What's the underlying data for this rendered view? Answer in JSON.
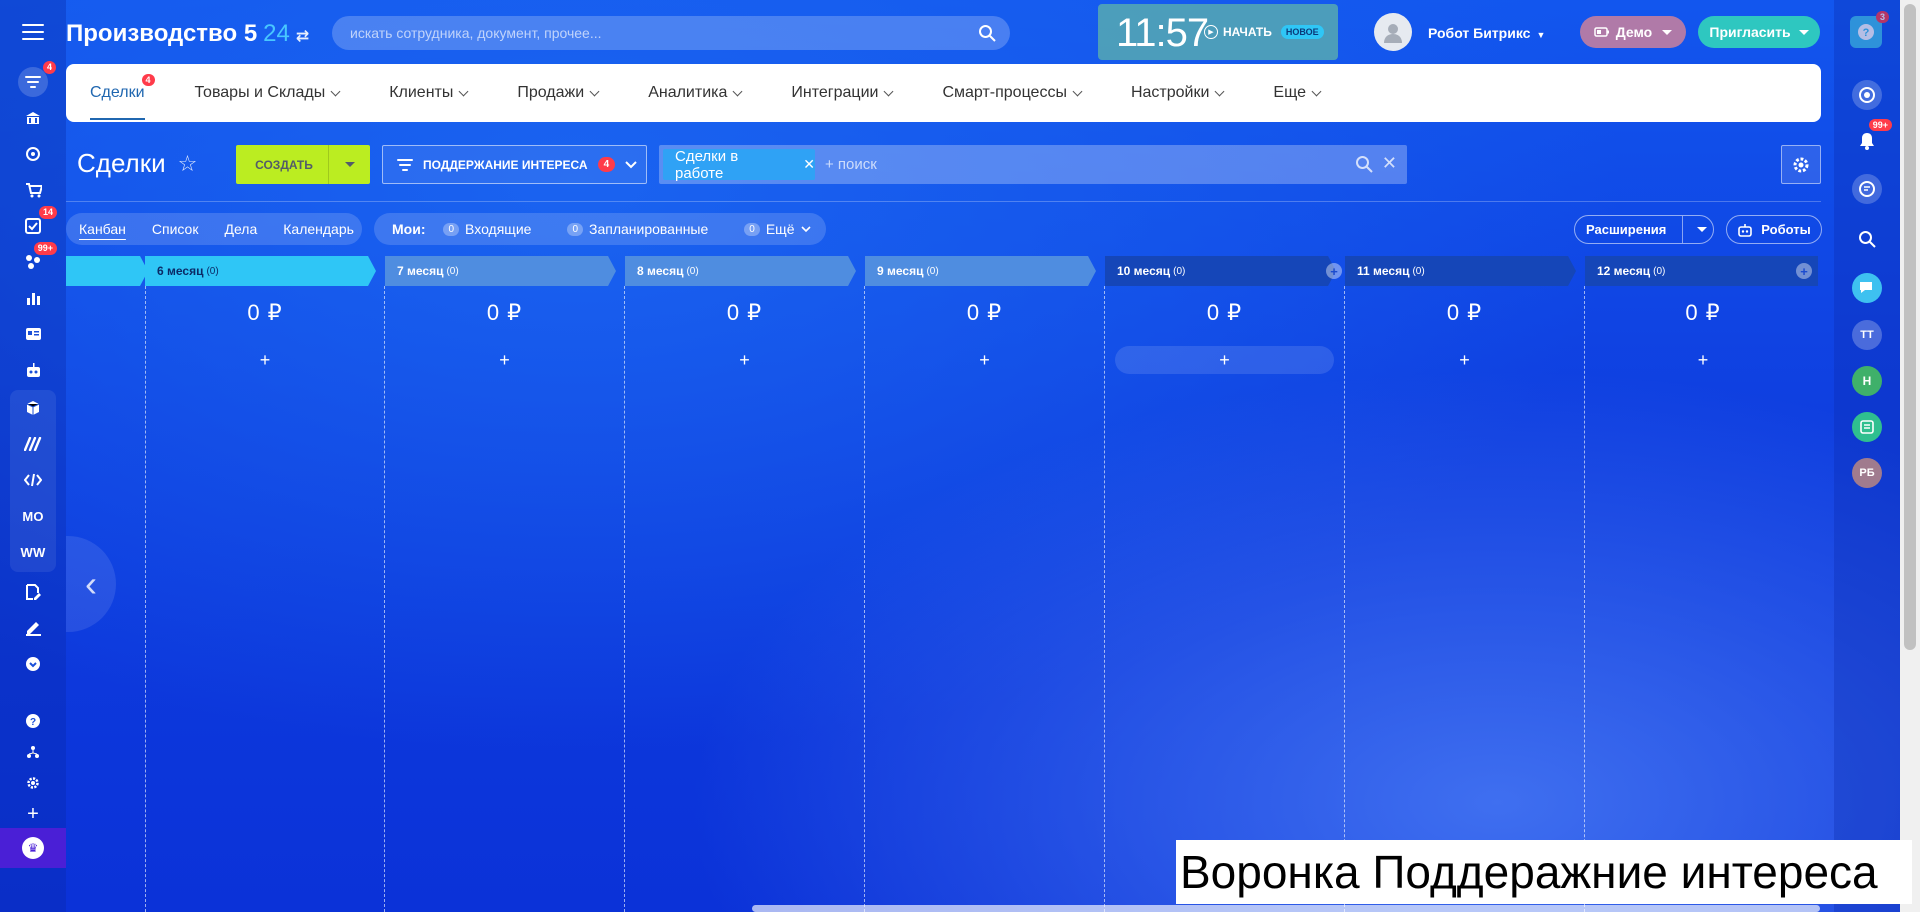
{
  "left_sidebar": {
    "items": [
      {
        "icon": "filter-icon",
        "badge": "4"
      },
      {
        "icon": "bank-icon",
        "badge": ""
      },
      {
        "icon": "target-icon",
        "badge": ""
      },
      {
        "icon": "cart-icon",
        "badge": ""
      },
      {
        "icon": "tasks-check-icon",
        "badge": "14"
      },
      {
        "icon": "scheme-icon",
        "badge": "99+"
      },
      {
        "icon": "chart-bars-icon",
        "badge": ""
      },
      {
        "icon": "contact-card-icon",
        "badge": ""
      },
      {
        "icon": "robot-icon",
        "badge": ""
      },
      {
        "icon": "cube-icon",
        "badge": ""
      },
      {
        "icon": "sites-icon",
        "badge": ""
      },
      {
        "icon": "code-icon",
        "badge": ""
      },
      {
        "icon": "mo-text-icon",
        "badge": "",
        "text": "MO"
      },
      {
        "icon": "ww-text-icon",
        "badge": "",
        "text": "WW"
      },
      {
        "icon": "document-edit-icon",
        "badge": ""
      },
      {
        "icon": "sign-icon",
        "badge": ""
      },
      {
        "icon": "chevron-circle-icon",
        "badge": ""
      },
      {
        "icon": "help-circle-icon",
        "badge": ""
      },
      {
        "icon": "structure-icon",
        "badge": ""
      },
      {
        "icon": "gear-icon",
        "badge": ""
      },
      {
        "icon": "plus-icon",
        "badge": ""
      },
      {
        "icon": "crown-icon",
        "badge": ""
      }
    ]
  },
  "header": {
    "portal_name": "Производство 5",
    "portal_suffix": "24",
    "search_placeholder": "искать сотрудника, документ, прочее...",
    "clock": "11:57",
    "start_label": "НАЧАТЬ",
    "new_badge": "НОВОЕ",
    "user_name": "Робот Битрикс",
    "demo_label": "Демо",
    "invite_label": "Пригласить",
    "help_badge": "3"
  },
  "topnav": {
    "items": [
      {
        "label": "Сделки",
        "badge": "4",
        "active": true
      },
      {
        "label": "Товары и Склады"
      },
      {
        "label": "Клиенты"
      },
      {
        "label": "Продажи"
      },
      {
        "label": "Аналитика"
      },
      {
        "label": "Интеграции"
      },
      {
        "label": "Смарт-процессы"
      },
      {
        "label": "Настройки"
      },
      {
        "label": "Еще"
      }
    ]
  },
  "toolbar": {
    "page_title": "Сделки",
    "create_label": "СОЗДАТЬ",
    "funnel_label": "ПОДДЕРЖАНИЕ ИНТЕРЕСА",
    "funnel_badge": "4",
    "filter_chip": "Сделки в работе",
    "filter_placeholder": "+ поиск"
  },
  "views": {
    "tabs": [
      "Канбан",
      "Список",
      "Дела",
      "Календарь"
    ],
    "my_label": "Мои:",
    "counters": [
      {
        "count": "0",
        "label": "Входящие"
      },
      {
        "count": "0",
        "label": "Запланированные"
      },
      {
        "count": "0",
        "label": "Ещё"
      }
    ],
    "extensions_label": "Расширения",
    "robots_label": "Роботы"
  },
  "kanban": {
    "stages": [
      {
        "name": "6 месяц",
        "count": "(0)",
        "sum": "0 ₽",
        "color": "#2fc6f6"
      },
      {
        "name": "7 месяц",
        "count": "(0)",
        "sum": "0 ₽",
        "color": "#4f8de0"
      },
      {
        "name": "8 месяц",
        "count": "(0)",
        "sum": "0 ₽",
        "color": "#4f8de0"
      },
      {
        "name": "9 месяц",
        "count": "(0)",
        "sum": "0 ₽",
        "color": "#4f8de0"
      },
      {
        "name": "10 месяц",
        "count": "(0)",
        "sum": "0 ₽",
        "color": "#1546b8"
      },
      {
        "name": "11 месяц",
        "count": "(0)",
        "sum": "0 ₽",
        "color": "#1546b8"
      },
      {
        "name": "12 месяц",
        "count": "(0)",
        "sum": "0 ₽",
        "color": "#1546b8"
      }
    ],
    "add_symbol": "+"
  },
  "right_sidebar": {
    "items": [
      {
        "icon": "copilot-icon",
        "text": "",
        "badge": ""
      },
      {
        "icon": "bell-icon",
        "text": "",
        "badge": "99+"
      },
      {
        "icon": "chat-icon",
        "text": "",
        "badge": ""
      },
      {
        "icon": "search-icon",
        "text": "",
        "badge": ""
      },
      {
        "icon": "chat-bubbles-icon",
        "text": "",
        "badge": ""
      },
      {
        "icon": "avatar-tt",
        "text": "ТТ",
        "badge": ""
      },
      {
        "icon": "avatar-n",
        "text": "Н",
        "badge": ""
      },
      {
        "icon": "calendar-avatar-icon",
        "text": "",
        "badge": ""
      },
      {
        "icon": "avatar-rb",
        "text": "РБ",
        "badge": ""
      }
    ]
  },
  "caption": "Воронка Поддеражние интереса"
}
